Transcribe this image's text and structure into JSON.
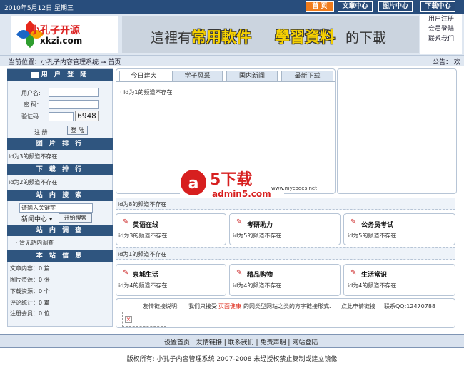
{
  "top": {
    "date": "2010年5月12日 星期三",
    "nav": [
      "首 页",
      "文章中心",
      "图片中心",
      "下载中心"
    ]
  },
  "header": {
    "logo": {
      "cn": "小孔子开源",
      "en": "xkzi.com"
    },
    "banner": {
      "a": "這裡有",
      "b": "常用軟件",
      "c": "學習資料",
      "d": "的下載"
    },
    "side_links": [
      "用户注册",
      "会员登陆",
      "联系我们"
    ]
  },
  "crumb": {
    "text": "当前位置：小孔子内容管理系统 → 首页",
    "notice": "公告：  欢"
  },
  "left": {
    "login": {
      "title": "用 户 登 陆",
      "username": "用户名:",
      "password": "密  码:",
      "captcha": "验证码:",
      "captcha_code": "6948",
      "register": "注 册",
      "login_btn": "登 陆"
    },
    "image_rank": {
      "title": "图 片 排 行",
      "text": "id为3的频道不存在"
    },
    "download_rank": {
      "title": "下 载 排 行",
      "text": "id为2的频道不存在"
    },
    "search": {
      "title": "站 内 搜 索",
      "placeholder": "请输入关键字",
      "select": "新闻中心",
      "button": "开始搜索"
    },
    "survey": {
      "title": "站 内 调 查",
      "text": "· 暂无站内调查"
    },
    "info": {
      "title": "本 站 信 息",
      "items": [
        "文章内容：0 篇",
        "图片资源：0 张",
        "下载资源：0 个",
        "评论统计：0 篇",
        "注册会员：0 位"
      ]
    }
  },
  "center": {
    "tabs": [
      "今日建大",
      "学子风采",
      "国内新闻",
      "最新下载"
    ],
    "tab_content": "· id为1的频道不存在",
    "watermark": {
      "text": "下载",
      "domain": "admin5.com",
      "url": "www.mycodes.net"
    },
    "line1": "id为8的频道不存在",
    "line2": "id为1的频道不存在",
    "boxes1": [
      {
        "title": "英语在线",
        "text": "id为3的频道不存在"
      },
      {
        "title": "考研助力",
        "text": "id为5的频道不存在"
      },
      {
        "title": "公务员考试",
        "text": "id为5的频道不存在"
      }
    ],
    "boxes2": [
      {
        "title": "泉城生活",
        "text": "id为4的频道不存在"
      },
      {
        "title": "精品购物",
        "text": "id为4的频道不存在"
      },
      {
        "title": "生活常识",
        "text": "id为4的频道不存在"
      }
    ],
    "links": {
      "prefix": "友情链接说明:",
      "text": "我们只接受",
      "highlight": "页面健康",
      "suffix": "的网类型网站之类的方字链接形式.",
      "apply": "点此申请链接",
      "contact": "联系QQ:12470788"
    }
  },
  "footer": {
    "links": [
      "设置首页",
      "|",
      "友情链接",
      "|",
      "联系我们",
      "|",
      "免责声明",
      "|",
      "网站登陆"
    ],
    "copyright": "版权所有: 小孔子内容管理系统  2007-2008  未经授权禁止复制或建立镜像"
  },
  "colors": {
    "primary": "#284d7c",
    "accent": "#f07c1c",
    "panel_border": "#b7c5d6"
  }
}
